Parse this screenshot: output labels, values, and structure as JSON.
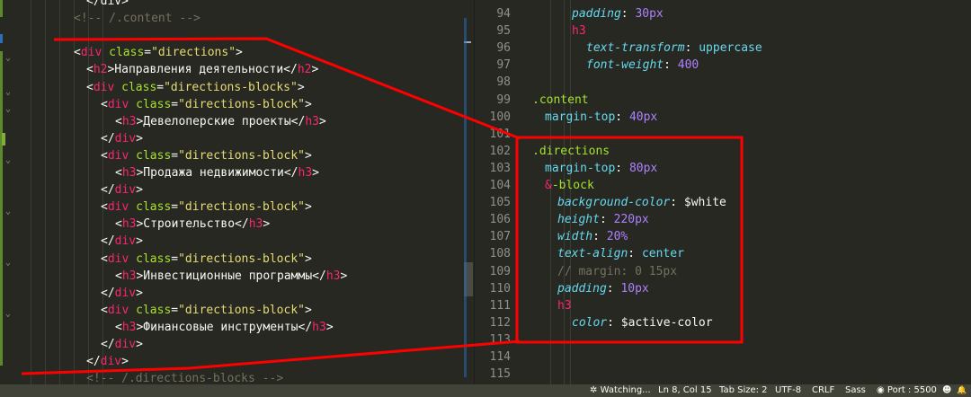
{
  "left_editor": {
    "lines": [
      {
        "id": "l0",
        "parts": [
          {
            "cls": "p",
            "t": "</div>"
          }
        ]
      },
      {
        "id": "l1",
        "parts": [
          {
            "cls": "c",
            "t": "<!-- /.content -->"
          }
        ]
      },
      {
        "id": "l2",
        "parts": []
      },
      {
        "id": "l3",
        "parts": [
          {
            "cls": "p",
            "t": "<"
          },
          {
            "cls": "t",
            "t": "div"
          },
          {
            "cls": "a",
            "t": " class"
          },
          {
            "cls": "p",
            "t": "="
          },
          {
            "cls": "s",
            "t": "\"directions\""
          },
          {
            "cls": "p",
            "t": ">"
          }
        ]
      },
      {
        "id": "l4",
        "parts": [
          {
            "cls": "p",
            "t": "<"
          },
          {
            "cls": "t",
            "t": "h2"
          },
          {
            "cls": "p",
            "t": ">Направления деятельности</"
          },
          {
            "cls": "t",
            "t": "h2"
          },
          {
            "cls": "p",
            "t": ">"
          }
        ]
      },
      {
        "id": "l5",
        "parts": [
          {
            "cls": "p",
            "t": "<"
          },
          {
            "cls": "t",
            "t": "div"
          },
          {
            "cls": "a",
            "t": " class"
          },
          {
            "cls": "p",
            "t": "="
          },
          {
            "cls": "s",
            "t": "\"directions-blocks\""
          },
          {
            "cls": "p",
            "t": ">"
          }
        ]
      },
      {
        "id": "l6",
        "parts": [
          {
            "cls": "p",
            "t": "<"
          },
          {
            "cls": "t",
            "t": "div"
          },
          {
            "cls": "a",
            "t": " class"
          },
          {
            "cls": "p",
            "t": "="
          },
          {
            "cls": "s",
            "t": "\"directions-block\""
          },
          {
            "cls": "p",
            "t": ">"
          }
        ]
      },
      {
        "id": "l7",
        "parts": [
          {
            "cls": "p",
            "t": "<"
          },
          {
            "cls": "t",
            "t": "h3"
          },
          {
            "cls": "p",
            "t": ">Девелоперские проекты</"
          },
          {
            "cls": "t",
            "t": "h3"
          },
          {
            "cls": "p",
            "t": ">"
          }
        ]
      },
      {
        "id": "l8",
        "parts": [
          {
            "cls": "p",
            "t": "</"
          },
          {
            "cls": "t",
            "t": "div"
          },
          {
            "cls": "p",
            "t": ">"
          }
        ]
      },
      {
        "id": "l9",
        "parts": [
          {
            "cls": "p",
            "t": "<"
          },
          {
            "cls": "t",
            "t": "div"
          },
          {
            "cls": "a",
            "t": " class"
          },
          {
            "cls": "p",
            "t": "="
          },
          {
            "cls": "s",
            "t": "\"directions-block\""
          },
          {
            "cls": "p",
            "t": ">"
          }
        ]
      },
      {
        "id": "l10",
        "parts": [
          {
            "cls": "p",
            "t": "<"
          },
          {
            "cls": "t",
            "t": "h3"
          },
          {
            "cls": "p",
            "t": ">Продажа недвижимости</"
          },
          {
            "cls": "t",
            "t": "h3"
          },
          {
            "cls": "p",
            "t": ">"
          }
        ]
      },
      {
        "id": "l11",
        "parts": [
          {
            "cls": "p",
            "t": "</"
          },
          {
            "cls": "t",
            "t": "div"
          },
          {
            "cls": "p",
            "t": ">"
          }
        ]
      },
      {
        "id": "l12",
        "parts": [
          {
            "cls": "p",
            "t": "<"
          },
          {
            "cls": "t",
            "t": "div"
          },
          {
            "cls": "a",
            "t": " class"
          },
          {
            "cls": "p",
            "t": "="
          },
          {
            "cls": "s",
            "t": "\"directions-block\""
          },
          {
            "cls": "p",
            "t": ">"
          }
        ]
      },
      {
        "id": "l13",
        "parts": [
          {
            "cls": "p",
            "t": "<"
          },
          {
            "cls": "t",
            "t": "h3"
          },
          {
            "cls": "p",
            "t": ">Строительство</"
          },
          {
            "cls": "t",
            "t": "h3"
          },
          {
            "cls": "p",
            "t": ">"
          }
        ]
      },
      {
        "id": "l14",
        "parts": [
          {
            "cls": "p",
            "t": "</"
          },
          {
            "cls": "t",
            "t": "div"
          },
          {
            "cls": "p",
            "t": ">"
          }
        ]
      },
      {
        "id": "l15",
        "parts": [
          {
            "cls": "p",
            "t": "<"
          },
          {
            "cls": "t",
            "t": "div"
          },
          {
            "cls": "a",
            "t": " class"
          },
          {
            "cls": "p",
            "t": "="
          },
          {
            "cls": "s",
            "t": "\"directions-block\""
          },
          {
            "cls": "p",
            "t": ">"
          }
        ]
      },
      {
        "id": "l16",
        "parts": [
          {
            "cls": "p",
            "t": "<"
          },
          {
            "cls": "t",
            "t": "h3"
          },
          {
            "cls": "p",
            "t": ">Инвестиционные программы</"
          },
          {
            "cls": "t",
            "t": "h3"
          },
          {
            "cls": "p",
            "t": ">"
          }
        ]
      },
      {
        "id": "l17",
        "parts": [
          {
            "cls": "p",
            "t": "</"
          },
          {
            "cls": "t",
            "t": "div"
          },
          {
            "cls": "p",
            "t": ">"
          }
        ]
      },
      {
        "id": "l18",
        "parts": [
          {
            "cls": "p",
            "t": "<"
          },
          {
            "cls": "t",
            "t": "div"
          },
          {
            "cls": "a",
            "t": " class"
          },
          {
            "cls": "p",
            "t": "="
          },
          {
            "cls": "s",
            "t": "\"directions-block\""
          },
          {
            "cls": "p",
            "t": ">"
          }
        ]
      },
      {
        "id": "l19",
        "parts": [
          {
            "cls": "p",
            "t": "<"
          },
          {
            "cls": "t",
            "t": "h3"
          },
          {
            "cls": "p",
            "t": ">Финансовые инструменты</"
          },
          {
            "cls": "t",
            "t": "h3"
          },
          {
            "cls": "p",
            "t": ">"
          }
        ]
      },
      {
        "id": "l20",
        "parts": [
          {
            "cls": "p",
            "t": "</"
          },
          {
            "cls": "t",
            "t": "div"
          },
          {
            "cls": "p",
            "t": ">"
          }
        ]
      },
      {
        "id": "l21",
        "parts": [
          {
            "cls": "p",
            "t": "</"
          },
          {
            "cls": "t",
            "t": "div"
          },
          {
            "cls": "p",
            "t": ">"
          }
        ]
      },
      {
        "id": "l22",
        "parts": [
          {
            "cls": "c",
            "t": "<!-- /.directions-blocks -->"
          }
        ]
      }
    ]
  },
  "right_editor": {
    "lines": [
      {
        "num": "94",
        "parts": [
          {
            "cls": "prop",
            "t": "padding"
          },
          {
            "cls": "p",
            "t": ": "
          },
          {
            "cls": "num",
            "t": "30px"
          }
        ]
      },
      {
        "num": "95",
        "parts": [
          {
            "cls": "t",
            "t": "h3"
          }
        ]
      },
      {
        "num": "96",
        "parts": [
          {
            "cls": "prop",
            "t": "text-transform"
          },
          {
            "cls": "p",
            "t": ": "
          },
          {
            "cls": "val",
            "t": "uppercase"
          }
        ]
      },
      {
        "num": "97",
        "parts": [
          {
            "cls": "prop",
            "t": "font-weight"
          },
          {
            "cls": "p",
            "t": ": "
          },
          {
            "cls": "num",
            "t": "400"
          }
        ]
      },
      {
        "num": "98",
        "parts": []
      },
      {
        "num": "99",
        "parts": [
          {
            "cls": "sel",
            "t": ".content"
          }
        ]
      },
      {
        "num": "100",
        "parts": [
          {
            "cls": "val",
            "t": "margin-top"
          },
          {
            "cls": "p",
            "t": ": "
          },
          {
            "cls": "num",
            "t": "40px"
          }
        ]
      },
      {
        "num": "101",
        "parts": []
      },
      {
        "num": "102",
        "parts": [
          {
            "cls": "sel",
            "t": ".directions"
          }
        ]
      },
      {
        "num": "103",
        "parts": [
          {
            "cls": "val",
            "t": "margin-top"
          },
          {
            "cls": "p",
            "t": ": "
          },
          {
            "cls": "num",
            "t": "80px"
          }
        ]
      },
      {
        "num": "104",
        "parts": [
          {
            "cls": "amp",
            "t": "&"
          },
          {
            "cls": "sel",
            "t": "-block"
          }
        ]
      },
      {
        "num": "105",
        "parts": [
          {
            "cls": "prop",
            "t": "background-color"
          },
          {
            "cls": "p",
            "t": ": "
          },
          {
            "cls": "var",
            "t": "$white"
          }
        ]
      },
      {
        "num": "106",
        "parts": [
          {
            "cls": "prop",
            "t": "height"
          },
          {
            "cls": "p",
            "t": ": "
          },
          {
            "cls": "num",
            "t": "220px"
          }
        ]
      },
      {
        "num": "107",
        "parts": [
          {
            "cls": "prop",
            "t": "width"
          },
          {
            "cls": "p",
            "t": ": "
          },
          {
            "cls": "num",
            "t": "20%"
          }
        ]
      },
      {
        "num": "108",
        "parts": [
          {
            "cls": "prop",
            "t": "text-align"
          },
          {
            "cls": "p",
            "t": ": "
          },
          {
            "cls": "val",
            "t": "center"
          }
        ]
      },
      {
        "num": "109",
        "parts": [
          {
            "cls": "c",
            "t": "// margin: 0 15px"
          }
        ]
      },
      {
        "num": "110",
        "parts": [
          {
            "cls": "prop",
            "t": "padding"
          },
          {
            "cls": "p",
            "t": ": "
          },
          {
            "cls": "num",
            "t": "10px"
          }
        ]
      },
      {
        "num": "111",
        "parts": [
          {
            "cls": "t",
            "t": "h3"
          }
        ]
      },
      {
        "num": "112",
        "parts": [
          {
            "cls": "prop",
            "t": "color"
          },
          {
            "cls": "p",
            "t": ": "
          },
          {
            "cls": "var",
            "t": "$active-color"
          }
        ]
      },
      {
        "num": "113",
        "parts": []
      },
      {
        "num": "114",
        "parts": []
      },
      {
        "num": "115",
        "parts": []
      }
    ]
  },
  "status_bar": {
    "watching": "Watching...",
    "position": "Ln 8, Col 15",
    "tab_size": "Tab Size: 2",
    "encoding": "UTF-8",
    "eol": "CRLF",
    "language": "Sass",
    "port": "Port : 5500",
    "smiley": "☻",
    "bell": "🔔"
  },
  "colors": {
    "annotation": "#ff0000",
    "background": "#272822"
  }
}
